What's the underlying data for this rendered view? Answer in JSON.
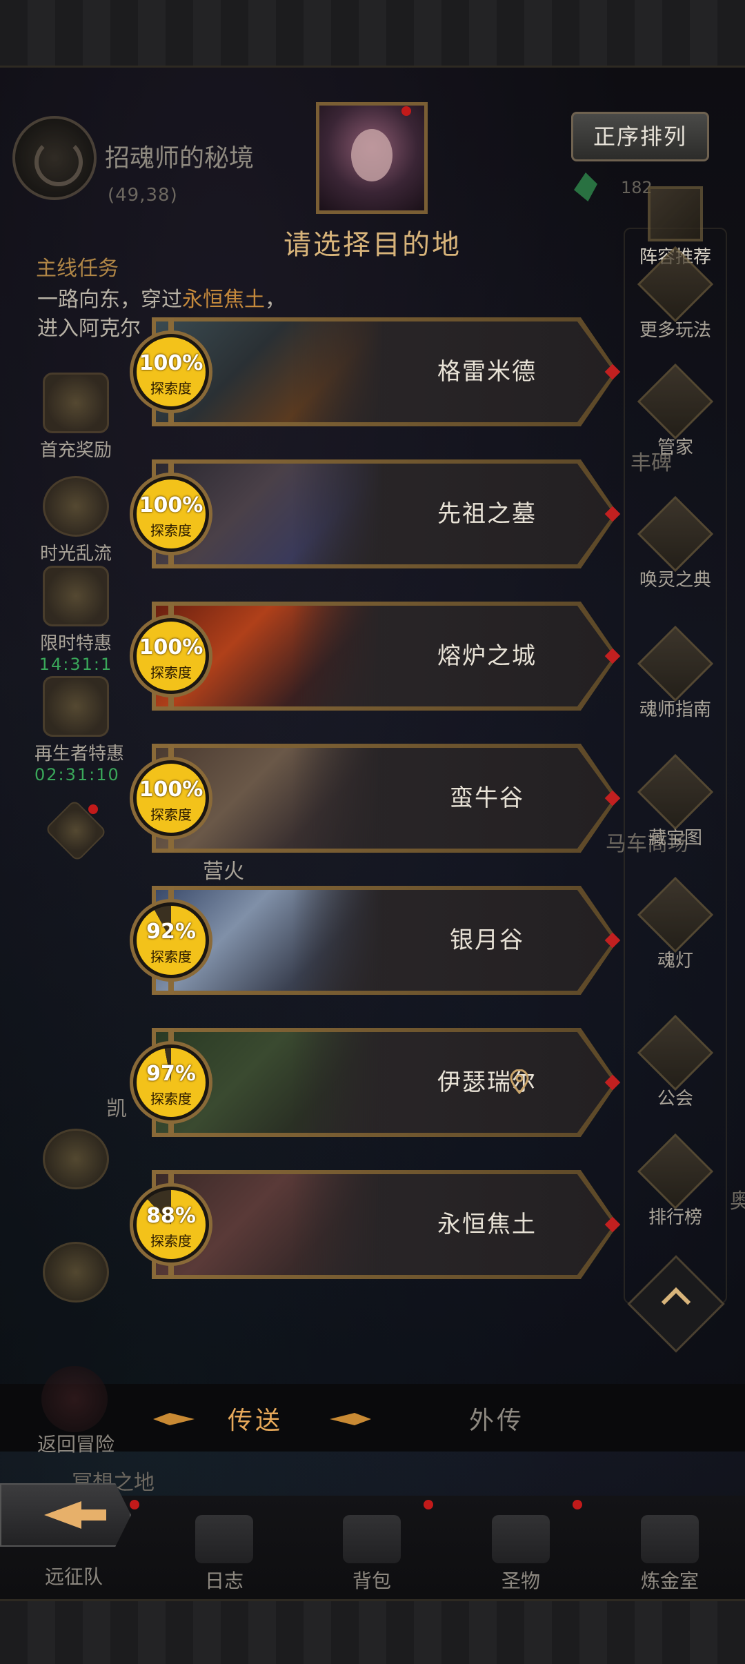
{
  "location": {
    "name": "招魂师的秘境",
    "coords": "(49,38)"
  },
  "top": {
    "sort_label": "正序排列",
    "gem_count": "182",
    "dialog_title": "请选择目的地"
  },
  "quest": {
    "title": "主线任务",
    "line1_a": "一路向东，穿过",
    "line1_hl": "永恒焦土",
    "line1_b": "，",
    "line2": "进入阿克尔"
  },
  "left_icons": [
    {
      "label": "首充奖励",
      "timer": ""
    },
    {
      "label": "时光乱流",
      "timer": ""
    },
    {
      "label": "限时特惠",
      "timer": "14:31:1"
    },
    {
      "label": "再生者特惠",
      "timer": "02:31:10"
    }
  ],
  "right_icons": [
    {
      "label": "阵容推荐"
    },
    {
      "label": "更多玩法"
    },
    {
      "label": "管家"
    },
    {
      "label": "唤灵之典"
    },
    {
      "label": "魂师指南"
    },
    {
      "label": "藏宝图"
    },
    {
      "label": "魂灯"
    },
    {
      "label": "公会"
    },
    {
      "label": "排行榜"
    }
  ],
  "world_labels": {
    "campfire": "营火",
    "abundance": "丰碑",
    "kai": "凯",
    "stable": "马车商场",
    "edge": "奥"
  },
  "progress_label": "探索度",
  "destinations": [
    {
      "name": "格雷米德",
      "progress": 100,
      "progress_text": "100%",
      "current": false
    },
    {
      "name": "先祖之墓",
      "progress": 100,
      "progress_text": "100%",
      "current": false
    },
    {
      "name": "熔炉之城",
      "progress": 100,
      "progress_text": "100%",
      "current": false
    },
    {
      "name": "蛮牛谷",
      "progress": 100,
      "progress_text": "100%",
      "current": false
    },
    {
      "name": "银月谷",
      "progress": 92,
      "progress_text": "92%",
      "current": false
    },
    {
      "name": "伊瑟瑞尔",
      "progress": 97,
      "progress_text": "97%",
      "current": true
    },
    {
      "name": "永恒焦土",
      "progress": 88,
      "progress_text": "88%",
      "current": false
    }
  ],
  "tabs": {
    "active": "传送",
    "other": "外传"
  },
  "return_label": "返回冒险",
  "meditation_label": "冥想之地",
  "bottom_nav": [
    {
      "label": "远征队"
    },
    {
      "label": "日志"
    },
    {
      "label": "背包"
    },
    {
      "label": "圣物"
    },
    {
      "label": "炼金室"
    }
  ],
  "colors": {
    "accent": "#d8b47a",
    "progress_yellow": "#f3c21a",
    "highlight": "#c68a3c",
    "timer_green": "#3aa85a"
  }
}
